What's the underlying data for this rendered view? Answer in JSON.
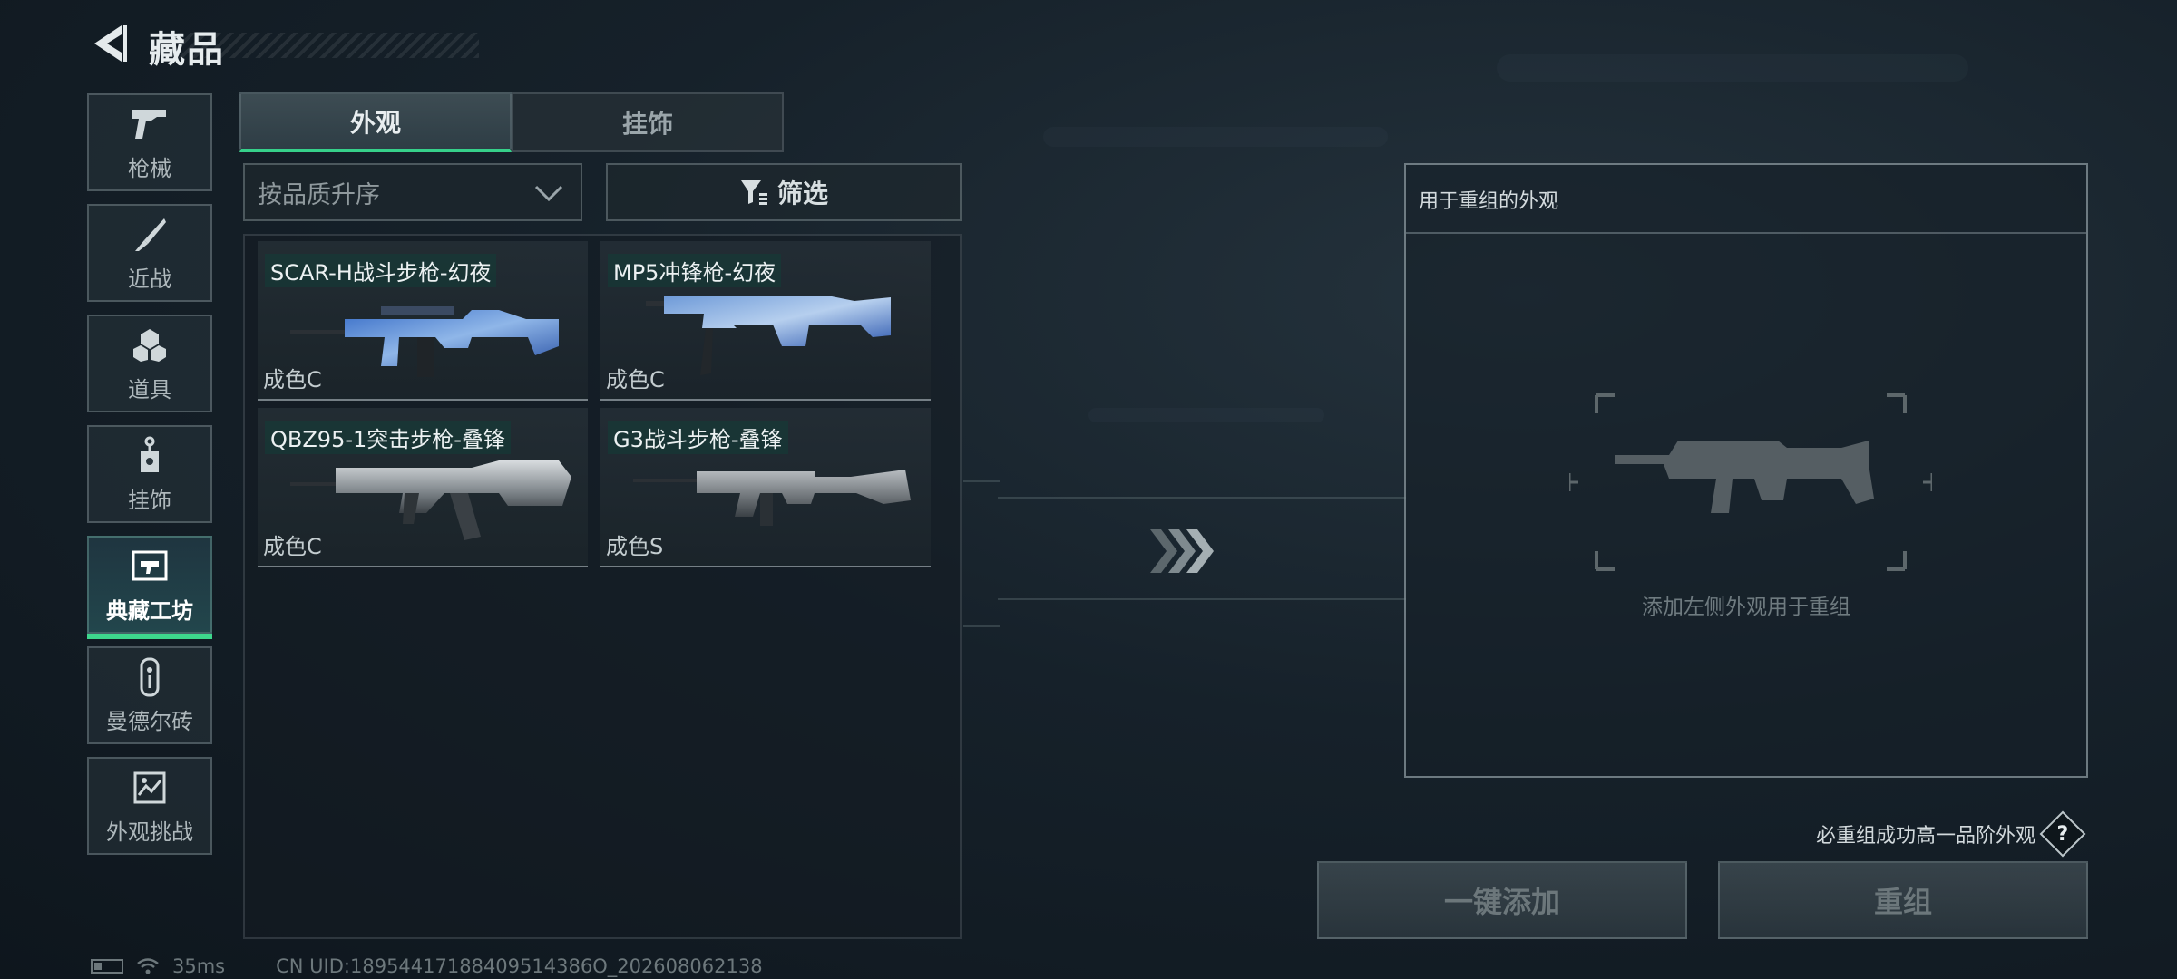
{
  "header": {
    "title": "藏品"
  },
  "sidebar": {
    "items": [
      {
        "label": "枪械",
        "icon": "pistol-icon"
      },
      {
        "label": "近战",
        "icon": "knife-icon"
      },
      {
        "label": "道具",
        "icon": "grenade-icon"
      },
      {
        "label": "挂饰",
        "icon": "charm-icon"
      },
      {
        "label": "典藏工坊",
        "icon": "workshop-icon",
        "active": true
      },
      {
        "label": "曼德尔砖",
        "icon": "mandel-brick-icon"
      },
      {
        "label": "外观挑战",
        "icon": "challenge-icon"
      }
    ]
  },
  "tabs": [
    {
      "label": "外观",
      "active": true
    },
    {
      "label": "挂饰",
      "active": false
    }
  ],
  "sort": {
    "value": "按品质升序"
  },
  "filter": {
    "label": "筛选"
  },
  "items": [
    {
      "name": "SCAR-H战斗步枪-幻夜",
      "grade": "成色C",
      "skin": "starry"
    },
    {
      "name": "MP5冲锋枪-幻夜",
      "grade": "成色C",
      "skin": "starry"
    },
    {
      "name": "QBZ95-1突击步枪-叠锋",
      "grade": "成色C",
      "skin": "steel"
    },
    {
      "name": "G3战斗步枪-叠锋",
      "grade": "成色S",
      "skin": "steel"
    }
  ],
  "recombine": {
    "title": "用于重组的外观",
    "placeholder": "添加左侧外观用于重组",
    "guarantee": "必重组成功高一品阶外观",
    "help": "?",
    "add_all_label": "一键添加",
    "recombine_label": "重组"
  },
  "status": {
    "ping": "35ms",
    "uid": "CN UID:18954417188409514386O_202608062138"
  },
  "colors": {
    "accent": "#36d08a",
    "background": "#16212a"
  }
}
